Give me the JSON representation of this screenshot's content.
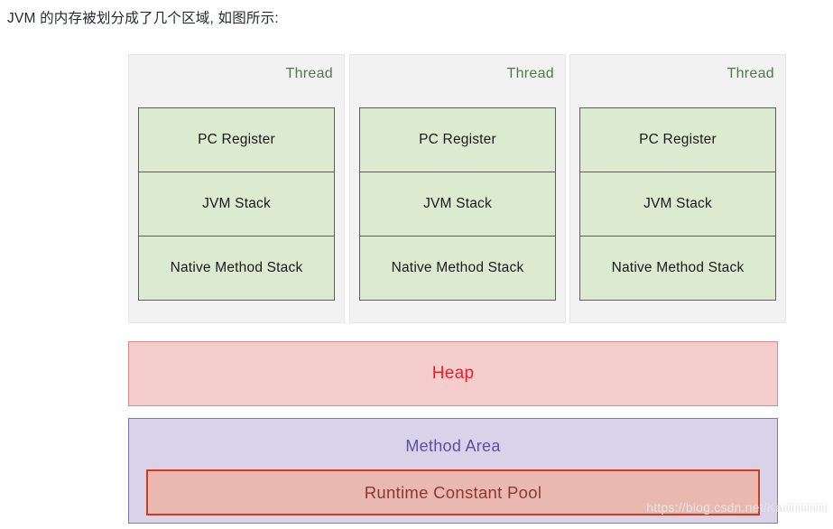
{
  "caption": "JVM 的内存被划分成了几个区域, 如图所示:",
  "diagram": {
    "threads": [
      {
        "label": "Thread",
        "regions": [
          "PC Register",
          "JVM Stack",
          "Native Method Stack"
        ]
      },
      {
        "label": "Thread",
        "regions": [
          "PC Register",
          "JVM Stack",
          "Native Method Stack"
        ]
      },
      {
        "label": "Thread",
        "regions": [
          "PC Register",
          "JVM Stack",
          "Native Method Stack"
        ]
      }
    ],
    "heap": {
      "label": "Heap"
    },
    "method_area": {
      "label": "Method Area",
      "constant_pool": {
        "label": "Runtime Constant Pool"
      }
    }
  },
  "watermark": "https://blog.csdn.net/Kaiiiiiiiiiiiiiii",
  "colors": {
    "thread_container_bg": "#f2f2f2",
    "thread_label": "#4f7a4a",
    "region_bg": "#dcead0",
    "region_border": "#5d5d5d",
    "heap_bg": "#f5cdcd",
    "heap_border": "#cf8d8d",
    "heap_text": "#ee1c23",
    "method_area_bg": "#d8d3e8",
    "method_area_border": "#7d77b5",
    "method_area_text": "#5a52a0",
    "constant_pool_bg": "#e9b8ae",
    "constant_pool_border": "#cc3b26",
    "constant_pool_text": "#8a3a32",
    "caption_text": "#24292e",
    "watermark_text": "#e4e4e4"
  }
}
